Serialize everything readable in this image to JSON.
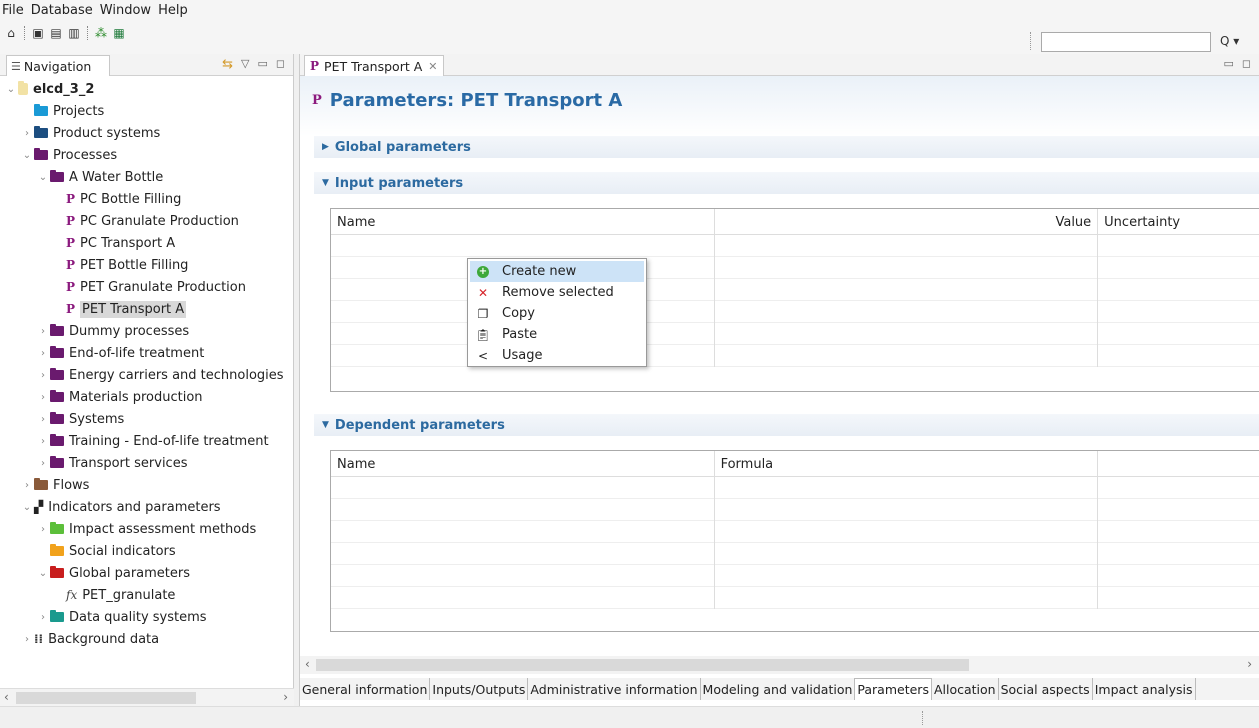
{
  "menubar": {
    "items": [
      "File",
      "Database",
      "Window",
      "Help"
    ]
  },
  "toolbar": {
    "icons": [
      "home-icon",
      "save-icon",
      "save-as-icon",
      "save-all-icon",
      "new-process-icon",
      "excel-icon"
    ],
    "search": {
      "value": "",
      "button": "Q ▾"
    }
  },
  "navigation": {
    "tab_label": "Navigation",
    "tree": [
      {
        "label": "elcd_3_2",
        "level": 0,
        "expander": "v",
        "icon": "database",
        "bold": true
      },
      {
        "label": "Projects",
        "level": 1,
        "expander": "",
        "icon": "folder-blue"
      },
      {
        "label": "Product systems",
        "level": 1,
        "expander": ">",
        "icon": "folder-dark"
      },
      {
        "label": "Processes",
        "level": 1,
        "expander": "v",
        "icon": "folder-purple"
      },
      {
        "label": "A Water Bottle",
        "level": 2,
        "expander": "v",
        "icon": "folder-purple"
      },
      {
        "label": "PC Bottle Filling",
        "level": 3,
        "expander": "",
        "icon": "process"
      },
      {
        "label": "PC Granulate Production",
        "level": 3,
        "expander": "",
        "icon": "process"
      },
      {
        "label": "PC Transport A",
        "level": 3,
        "expander": "",
        "icon": "process"
      },
      {
        "label": "PET Bottle Filling",
        "level": 3,
        "expander": "",
        "icon": "process"
      },
      {
        "label": "PET Granulate Production",
        "level": 3,
        "expander": "",
        "icon": "process"
      },
      {
        "label": "PET Transport A",
        "level": 3,
        "expander": "",
        "icon": "process",
        "selected": true
      },
      {
        "label": "Dummy processes",
        "level": 2,
        "expander": ">",
        "icon": "folder-purple"
      },
      {
        "label": "End-of-life treatment",
        "level": 2,
        "expander": ">",
        "icon": "folder-purple"
      },
      {
        "label": "Energy carriers and technologies",
        "level": 2,
        "expander": ">",
        "icon": "folder-purple"
      },
      {
        "label": "Materials production",
        "level": 2,
        "expander": ">",
        "icon": "folder-purple"
      },
      {
        "label": "Systems",
        "level": 2,
        "expander": ">",
        "icon": "folder-purple"
      },
      {
        "label": "Training - End-of-life treatment",
        "level": 2,
        "expander": ">",
        "icon": "folder-purple"
      },
      {
        "label": "Transport services",
        "level": 2,
        "expander": ">",
        "icon": "folder-purple"
      },
      {
        "label": "Flows",
        "level": 1,
        "expander": ">",
        "icon": "folder-brown"
      },
      {
        "label": "Indicators and parameters",
        "level": 1,
        "expander": "v",
        "icon": "indicators"
      },
      {
        "label": "Impact assessment methods",
        "level": 2,
        "expander": ">",
        "icon": "folder-green"
      },
      {
        "label": "Social indicators",
        "level": 2,
        "expander": "",
        "icon": "folder-orange"
      },
      {
        "label": "Global parameters",
        "level": 2,
        "expander": "v",
        "icon": "folder-red"
      },
      {
        "label": "PET_granulate",
        "level": 3,
        "expander": "",
        "icon": "fx"
      },
      {
        "label": "Data quality systems",
        "level": 2,
        "expander": ">",
        "icon": "folder-teal"
      },
      {
        "label": "Background data",
        "level": 1,
        "expander": ">",
        "icon": "grid"
      }
    ]
  },
  "editor": {
    "tab_label": "PET Transport A",
    "page_title": "Parameters: PET Transport A",
    "sections": {
      "global": "Global parameters",
      "input": "Input parameters",
      "dependent": "Dependent parameters"
    },
    "input_table": {
      "columns": [
        "Name",
        "Value",
        "Uncertainty"
      ]
    },
    "dependent_table": {
      "columns": [
        "Name",
        "Formula",
        ""
      ]
    },
    "page_tabs": [
      "General information",
      "Inputs/Outputs",
      "Administrative information",
      "Modeling and validation",
      "Parameters",
      "Allocation",
      "Social aspects",
      "Impact analysis"
    ],
    "active_page_tab": "Parameters"
  },
  "context_menu": {
    "items": [
      {
        "label": "Create new",
        "icon": "add-icon",
        "hover": true
      },
      {
        "label": "Remove selected",
        "icon": "remove-icon"
      },
      {
        "label": "Copy",
        "icon": "copy-icon"
      },
      {
        "label": "Paste",
        "icon": "paste-icon"
      },
      {
        "label": "Usage",
        "icon": "share-icon"
      }
    ]
  },
  "colors": {
    "accent": "#2a6aa5",
    "process_icon": "#8b1a7e",
    "menu_hover": "#cde3f7"
  }
}
